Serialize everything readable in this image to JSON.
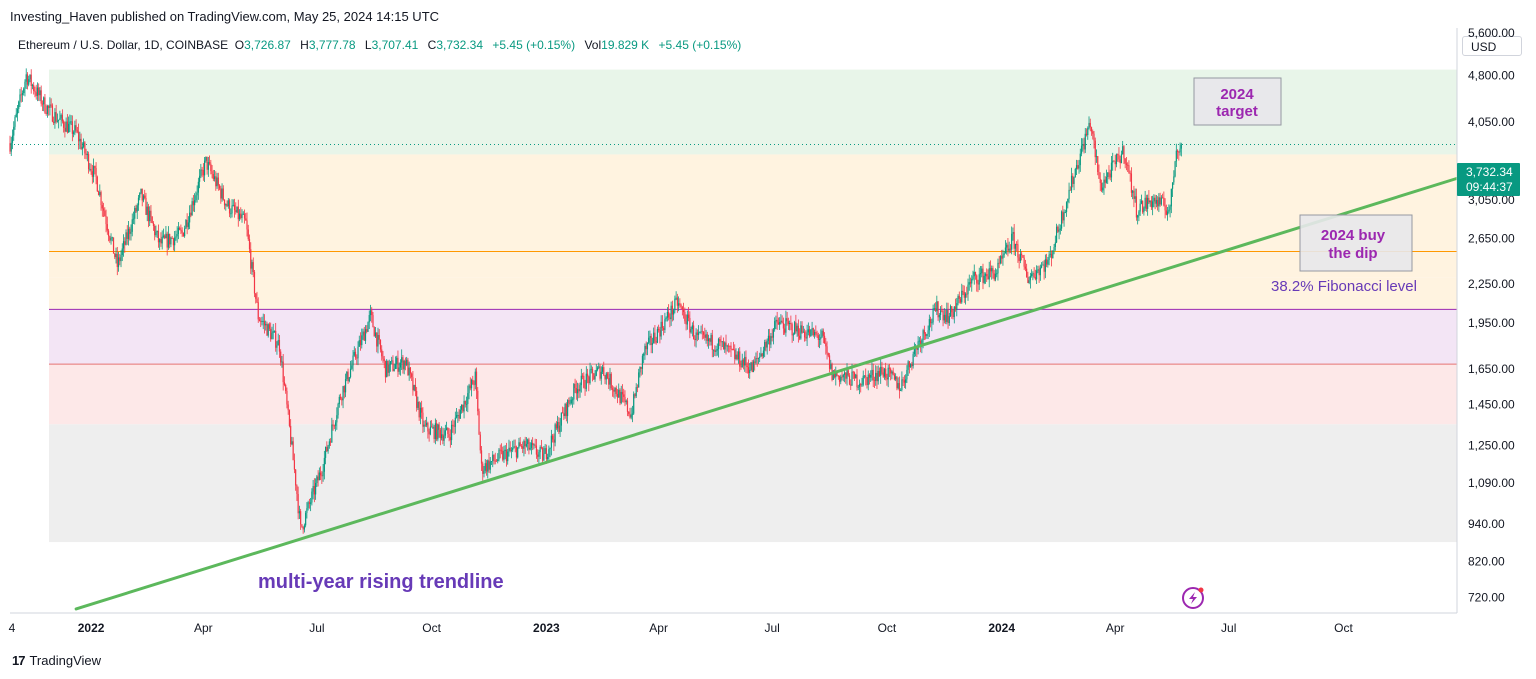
{
  "header": {
    "published": "Investing_Haven published on TradingView.com, May 25, 2024 14:15 UTC"
  },
  "symbol": {
    "name": "Ethereum / U.S. Dollar, 1D, COINBASE",
    "o_label": "O",
    "o_value": "3,726.87",
    "h_label": "H",
    "h_value": "3,777.78",
    "l_label": "L",
    "l_value": "3,707.41",
    "c_label": "C",
    "c_value": "3,732.34",
    "change": "+5.45 (+0.15%)",
    "vol_label": "Vol",
    "vol_value": "19.829 K",
    "vol_change": "+5.45 (+0.15%)"
  },
  "currency_button": "USD",
  "footer": {
    "logo": "17",
    "brand": "TradingView"
  },
  "colors": {
    "up": "#089981",
    "down": "#f23645",
    "trendline": "#5cb85c",
    "annotation_purple": "#9c27b0",
    "fib_text": "#673ab7",
    "price_label_bg": "#089981"
  },
  "chart_data": {
    "type": "candlestick",
    "y_scale": "log",
    "ylim": [
      680,
      5700
    ],
    "y_ticks": [
      {
        "value": 5600,
        "label": "5,600.00"
      },
      {
        "value": 4800,
        "label": "4,800.00"
      },
      {
        "value": 4050,
        "label": "4,050.00"
      },
      {
        "value": 3050,
        "label": "3,050.00"
      },
      {
        "value": 2650,
        "label": "2,650.00"
      },
      {
        "value": 2250,
        "label": "2,250.00"
      },
      {
        "value": 1950,
        "label": "1,950.00"
      },
      {
        "value": 1650,
        "label": "1,650.00"
      },
      {
        "value": 1450,
        "label": "1,450.00"
      },
      {
        "value": 1250,
        "label": "1,250.00"
      },
      {
        "value": 1090,
        "label": "1,090.00"
      },
      {
        "value": 940,
        "label": "940.00"
      },
      {
        "value": 820,
        "label": "820.00"
      },
      {
        "value": 720,
        "label": "720.00"
      }
    ],
    "xlim": [
      "2021-10-28",
      "2024-12-31"
    ],
    "x_ticks": [
      {
        "date": "2021-10-01",
        "label": "4"
      },
      {
        "date": "2022-01-01",
        "label": "2022"
      },
      {
        "date": "2022-04-01",
        "label": "Apr"
      },
      {
        "date": "2022-07-01",
        "label": "Jul"
      },
      {
        "date": "2022-10-01",
        "label": "Oct"
      },
      {
        "date": "2023-01-01",
        "label": "2023"
      },
      {
        "date": "2023-04-01",
        "label": "Apr"
      },
      {
        "date": "2023-07-01",
        "label": "Jul"
      },
      {
        "date": "2023-10-01",
        "label": "Oct"
      },
      {
        "date": "2024-01-01",
        "label": "2024"
      },
      {
        "date": "2024-04-01",
        "label": "Apr"
      },
      {
        "date": "2024-07-01",
        "label": "Jul"
      },
      {
        "date": "2024-10-01",
        "label": "Oct"
      }
    ],
    "price_path": [
      [
        "2021-10-28",
        3750
      ],
      [
        "2021-11-10",
        4800
      ],
      [
        "2021-11-25",
        4300
      ],
      [
        "2021-12-05",
        4100
      ],
      [
        "2021-12-20",
        3900
      ],
      [
        "2022-01-05",
        3300
      ],
      [
        "2022-01-22",
        2400
      ],
      [
        "2022-02-10",
        3100
      ],
      [
        "2022-02-25",
        2600
      ],
      [
        "2022-03-15",
        2700
      ],
      [
        "2022-04-03",
        3500
      ],
      [
        "2022-04-20",
        3000
      ],
      [
        "2022-05-05",
        2800
      ],
      [
        "2022-05-15",
        2000
      ],
      [
        "2022-06-01",
        1800
      ],
      [
        "2022-06-14",
        1100
      ],
      [
        "2022-06-18",
        920
      ],
      [
        "2022-07-05",
        1150
      ],
      [
        "2022-07-20",
        1500
      ],
      [
        "2022-08-13",
        2000
      ],
      [
        "2022-08-25",
        1650
      ],
      [
        "2022-09-10",
        1700
      ],
      [
        "2022-09-25",
        1330
      ],
      [
        "2022-10-15",
        1300
      ],
      [
        "2022-11-05",
        1600
      ],
      [
        "2022-11-10",
        1150
      ],
      [
        "2022-11-25",
        1200
      ],
      [
        "2022-12-15",
        1250
      ],
      [
        "2022-12-30",
        1200
      ],
      [
        "2023-01-25",
        1550
      ],
      [
        "2023-02-15",
        1650
      ],
      [
        "2023-03-10",
        1400
      ],
      [
        "2023-03-20",
        1750
      ],
      [
        "2023-04-16",
        2100
      ],
      [
        "2023-05-01",
        1850
      ],
      [
        "2023-05-20",
        1800
      ],
      [
        "2023-06-15",
        1650
      ],
      [
        "2023-07-05",
        1950
      ],
      [
        "2023-07-15",
        1920
      ],
      [
        "2023-08-10",
        1850
      ],
      [
        "2023-08-18",
        1620
      ],
      [
        "2023-09-10",
        1580
      ],
      [
        "2023-09-28",
        1640
      ],
      [
        "2023-10-12",
        1550
      ],
      [
        "2023-10-25",
        1800
      ],
      [
        "2023-11-10",
        2050
      ],
      [
        "2023-11-20",
        2000
      ],
      [
        "2023-12-10",
        2300
      ],
      [
        "2023-12-28",
        2350
      ],
      [
        "2024-01-10",
        2650
      ],
      [
        "2024-01-22",
        2300
      ],
      [
        "2024-02-08",
        2450
      ],
      [
        "2024-02-28",
        3350
      ],
      [
        "2024-03-12",
        4050
      ],
      [
        "2024-03-20",
        3200
      ],
      [
        "2024-04-08",
        3650
      ],
      [
        "2024-04-18",
        2950
      ],
      [
        "2024-05-01",
        3050
      ],
      [
        "2024-05-15",
        2950
      ],
      [
        "2024-05-20",
        3700
      ],
      [
        "2024-05-24",
        3732
      ]
    ],
    "last_price": {
      "value": 3732.34,
      "label": "3,732.34",
      "countdown": "09:44:37"
    },
    "zones": [
      {
        "from": 3600,
        "to": 4900,
        "color": "#e8f5e9"
      },
      {
        "from": 2300,
        "to": 3600,
        "color": "#fff3e0"
      },
      {
        "from": 2050,
        "to": 2300,
        "color": "#fff3e0"
      },
      {
        "from": 1680,
        "to": 2050,
        "color": "#f3e5f5"
      },
      {
        "from": 1350,
        "to": 1680,
        "color": "#fde8e8"
      },
      {
        "from": 880,
        "to": 1350,
        "color": "#eeeeee"
      }
    ],
    "levels": [
      {
        "value": 2530,
        "color": "#ff9800"
      },
      {
        "value": 2050,
        "color": "#9c27b0"
      },
      {
        "value": 1680,
        "color": "#e57373"
      }
    ],
    "trendline": {
      "start": [
        "2021-12-20",
        690
      ],
      "end": [
        "2024-12-31",
        3300
      ]
    },
    "annotations": {
      "target": "2024\ntarget",
      "buy_dip": "2024 buy\nthe dip",
      "fib": "38.2% Fibonacci level",
      "trendline_label": "multi-year rising trendline"
    }
  }
}
